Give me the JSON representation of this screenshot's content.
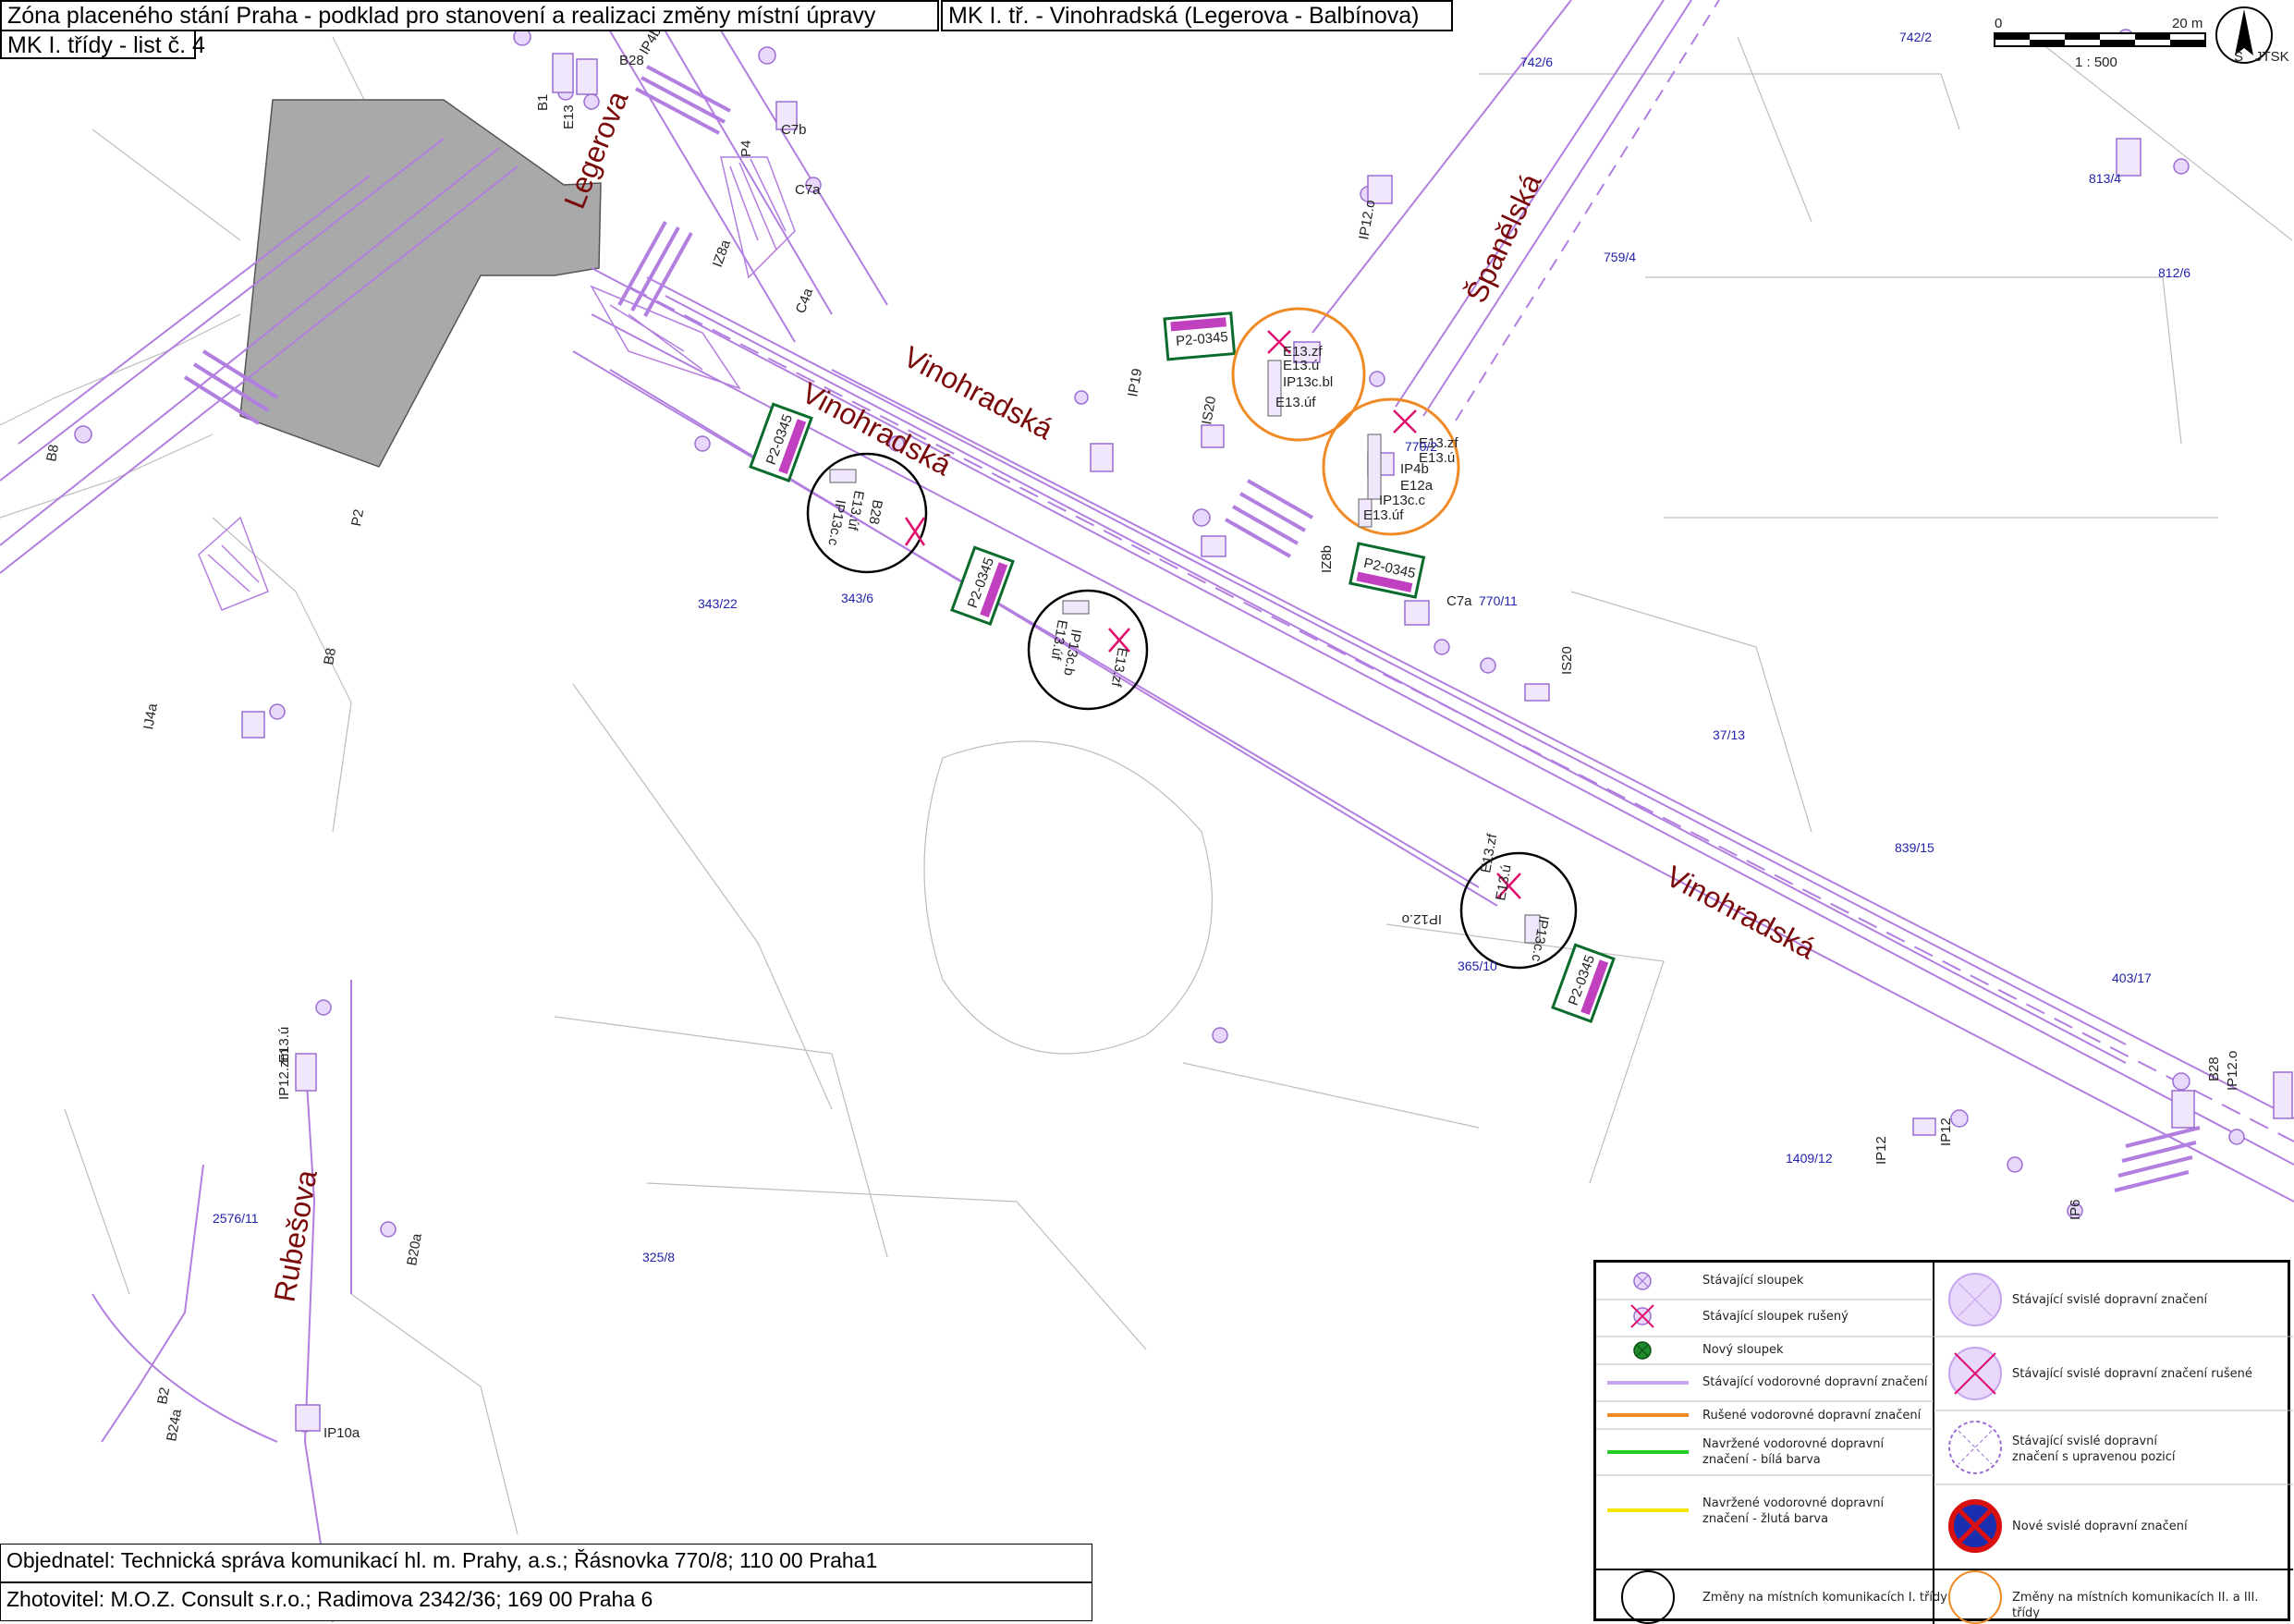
{
  "header": {
    "title": "Zóna placeného stání Praha - podklad pro stanovení a realizaci změny místní úpravy",
    "section": "MK I. tř. - Vinohradská (Legerova - Balbínova)",
    "sheet": "MK I. třídy - list č. 4"
  },
  "scale": {
    "zero": "0",
    "max": "20 m",
    "ratio": "1 : 500",
    "north": "S",
    "system": "JTSK"
  },
  "streets": {
    "legerova": "Legerova",
    "spanelska": "Španělská",
    "vinohradska": "Vinohradská",
    "rubesova": "Rubešova"
  },
  "plots": [
    "742/6",
    "742/2",
    "813/4",
    "759/4",
    "812/6",
    "770/2",
    "770/11",
    "343/22",
    "343/6",
    "37/13",
    "839/15",
    "403/17",
    "365/10",
    "1409/12",
    "2576/11",
    "325/8"
  ],
  "signs": {
    "p2": "P2-0345",
    "codes_a": [
      "E13.zf",
      "E13.ú",
      "IP13c.bl",
      "E13.úf"
    ],
    "codes_b": [
      "E13.zf",
      "E13.ú",
      "IP4b",
      "E12a",
      "IP13c.c",
      "E13.úf"
    ],
    "codes_c": [
      "IP13c.c",
      "E13.úf",
      "B28"
    ],
    "codes_d": [
      "IP13c.b",
      "E13.úf",
      "E13.zf"
    ],
    "codes_e": [
      "E13.zf",
      "E13.ú",
      "IP13c.c",
      "IP12.o"
    ],
    "misc": [
      "B28",
      "B1",
      "E13",
      "IZ8a",
      "IP4b",
      "C7b",
      "C7a",
      "P4",
      "C4a",
      "IP19",
      "IS20",
      "P2",
      "B8",
      "IJ4a",
      "IP12.o",
      "IP12.zm",
      "E13.ú",
      "B20a",
      "B24a",
      "IP10a",
      "B2",
      "IP12",
      "IP6",
      "IZ8b"
    ]
  },
  "legend": {
    "left": [
      "Stávající sloupek",
      "Stávající sloupek rušený",
      "Nový sloupek",
      "Stávající vodorovné dopravní značení",
      "Rušené vodorovné dopravní značení",
      "Navržené vodorovné dopravní značení - bílá barva",
      "Navržené vodorovné dopravní značení - žlutá barva",
      "Změny na místních komunikacích I. třídy"
    ],
    "right": [
      "Stávající svislé dopravní značení",
      "Stávající svislé dopravní značení rušené",
      "Stávající svislé dopravní značení s upravenou pozicí",
      "Nové svislé dopravní značení",
      "Změny na místních komunikacích II. a III. třídy"
    ]
  },
  "footer": {
    "client": "Objednatel: Technická správa komunikací hl. m. Prahy, a.s.; Řásnovka 770/8; 110 00 Praha1",
    "contractor": "Zhotovitel: M.O.Z. Consult s.r.o.; Radimova 2342/36; 169 00 Praha 6"
  },
  "colors": {
    "marking": "#b27ee0",
    "street_label": "#7a0a0a",
    "plot_label": "#2222aa",
    "building": "#a9a9a9",
    "change_class1": "#000000",
    "change_class23": "#f08a24",
    "cancel": "#e0106e",
    "new_white": "#22cc22",
    "new_yellow": "#f2e600"
  }
}
